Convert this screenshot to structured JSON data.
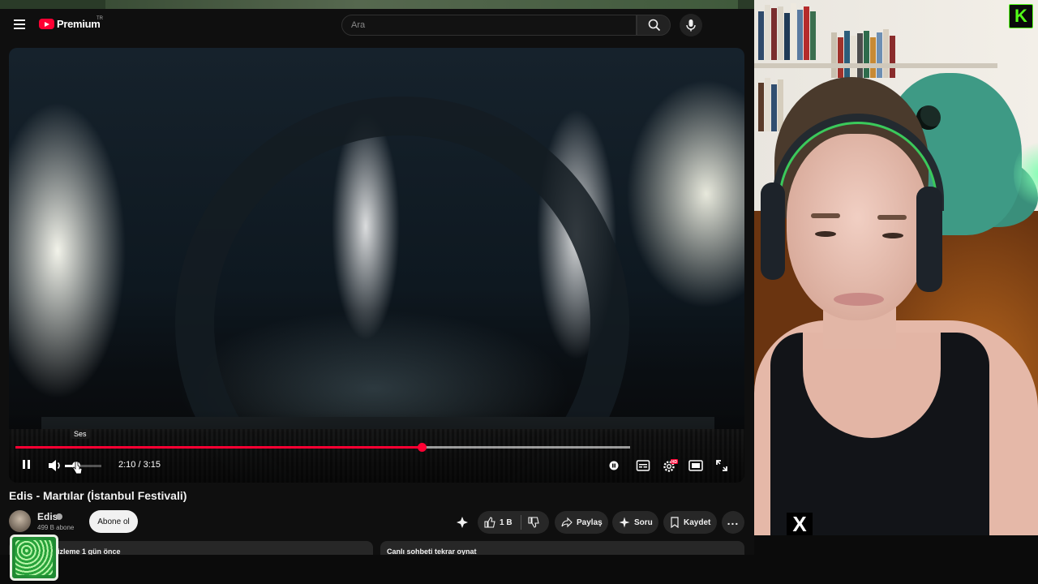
{
  "masthead": {
    "logo_text": "Premium",
    "country_code": "TR",
    "search_placeholder": "Ara"
  },
  "player": {
    "volume_tooltip": "Ses",
    "time_display": "2:10 / 3:15",
    "progress_fraction": 0.661,
    "buffered_fraction": 1.0,
    "volume_fraction": 0.3,
    "settings_badge": "HD",
    "accent_color": "#ff0033"
  },
  "video": {
    "title": "Edis - Martılar (İstanbul Festivali)",
    "channel_name": "Edis",
    "subscriber_count": "499 B abone",
    "subscribe_label": "Abone ol",
    "like_count": "1 B",
    "share_label": "Paylaş",
    "ask_label": "Soru",
    "save_label": "Kaydet"
  },
  "below": {
    "card_left": "izleme  1 gün önce",
    "card_right": "Canlı sohbeti tekrar oynat"
  },
  "overlay": {
    "kick_letter": "K",
    "x_letter": "X",
    "kick_color": "#53fc18"
  }
}
